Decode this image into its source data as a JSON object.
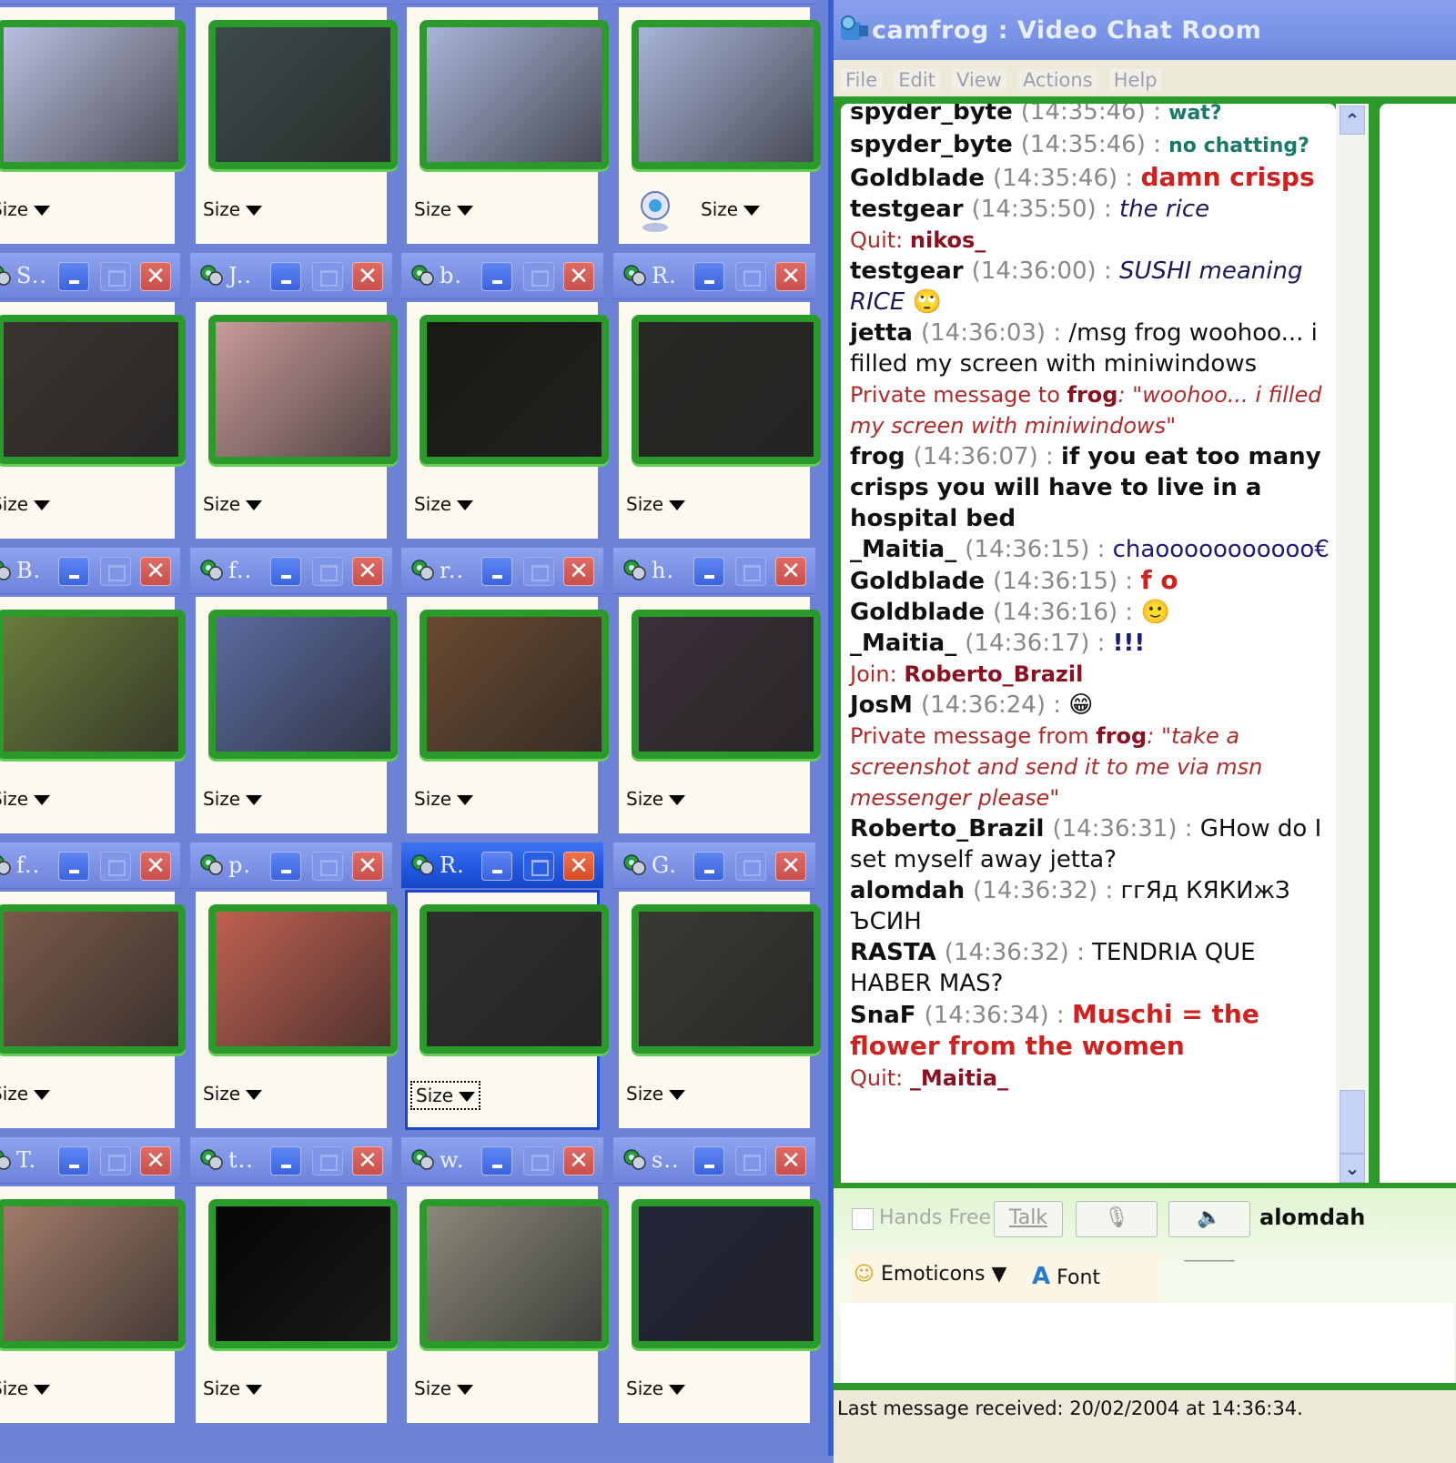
{
  "app": {
    "title": "camfrog : Video Chat Room",
    "menu": [
      "File",
      "Edit",
      "View",
      "Actions",
      "Help"
    ]
  },
  "video_tiles": [
    {
      "title": "",
      "size_label": "Size",
      "active": false,
      "webcam_icon": false,
      "thumb_color": "#b9bfe0"
    },
    {
      "title": "",
      "size_label": "Size",
      "active": false,
      "webcam_icon": false,
      "thumb_color": "#3c4a4a"
    },
    {
      "title": "",
      "size_label": "Size",
      "active": false,
      "webcam_icon": false,
      "thumb_color": "#a8b4d8"
    },
    {
      "title": "",
      "size_label": "Size",
      "active": false,
      "webcam_icon": true,
      "thumb_color": "#a8b4d8"
    },
    {
      "title": "S..",
      "size_label": "Size",
      "active": false,
      "webcam_icon": false,
      "thumb_color": "#3a3430"
    },
    {
      "title": "J..",
      "size_label": "Size",
      "active": false,
      "webcam_icon": false,
      "thumb_color": "#c89a98"
    },
    {
      "title": "b.",
      "size_label": "Size",
      "active": false,
      "webcam_icon": false,
      "thumb_color": "#1a1a14"
    },
    {
      "title": "R.",
      "size_label": "Size",
      "active": false,
      "webcam_icon": false,
      "thumb_color": "#2a2824"
    },
    {
      "title": "B.",
      "size_label": "Size",
      "active": false,
      "webcam_icon": false,
      "thumb_color": "#6a7a3a"
    },
    {
      "title": "f..",
      "size_label": "Size",
      "active": false,
      "webcam_icon": false,
      "thumb_color": "#5a6aa0"
    },
    {
      "title": "r..",
      "size_label": "Size",
      "active": false,
      "webcam_icon": false,
      "thumb_color": "#6a4a30"
    },
    {
      "title": "h.",
      "size_label": "Size",
      "active": false,
      "webcam_icon": false,
      "thumb_color": "#3a3038"
    },
    {
      "title": "f..",
      "size_label": "Size",
      "active": false,
      "webcam_icon": false,
      "thumb_color": "#7a5a4a"
    },
    {
      "title": "p.",
      "size_label": "Size",
      "active": false,
      "webcam_icon": false,
      "thumb_color": "#c06050"
    },
    {
      "title": "R.",
      "size_label": "Size",
      "active": true,
      "webcam_icon": false,
      "thumb_color": "#2e2e2e"
    },
    {
      "title": "G.",
      "size_label": "Size",
      "active": false,
      "webcam_icon": false,
      "thumb_color": "#3a3a34"
    },
    {
      "title": "T.",
      "size_label": "Size",
      "active": false,
      "webcam_icon": false,
      "thumb_color": "#a07a68"
    },
    {
      "title": "t..",
      "size_label": "Size",
      "active": false,
      "webcam_icon": false,
      "thumb_color": "#050505"
    },
    {
      "title": "w.",
      "size_label": "Size",
      "active": false,
      "webcam_icon": false,
      "thumb_color": "#8a8878"
    },
    {
      "title": "s..",
      "size_label": "Size",
      "active": false,
      "webcam_icon": false,
      "thumb_color": "#222438"
    }
  ],
  "chat": {
    "messages": [
      {
        "type": "msg",
        "nick": "spyder_byte",
        "time": "(14:35:46)",
        "text": "wat?",
        "color": "#1a7a6a",
        "style": "comic"
      },
      {
        "type": "msg",
        "nick": "spyder_byte",
        "time": "(14:35:46)",
        "text": "no chatting?",
        "color": "#1a7a6a",
        "style": "comic"
      },
      {
        "type": "msg",
        "nick": "Goldblade",
        "time": "(14:35:46)",
        "text": "damn crisps",
        "color": "#d02020",
        "style": "comic-big"
      },
      {
        "type": "msg",
        "nick": "testgear",
        "time": "(14:35:50)",
        "text": "the rice",
        "color": "#1a1a5a",
        "style": "italic"
      },
      {
        "type": "sys",
        "prefix": "Quit: ",
        "name": "nikos_",
        "suffix": ""
      },
      {
        "type": "msg",
        "nick": "testgear",
        "time": "(14:36:00)",
        "text": "SUSHI meaning RICE",
        "color": "#1a1a5a",
        "style": "italic",
        "emoticon": "rolling-eyes"
      },
      {
        "type": "msg",
        "nick": "jetta",
        "time": "(14:36:03)",
        "text": "/msg frog woohoo... i filled my screen with miniwindows",
        "color": "#111111",
        "style": "plain"
      },
      {
        "type": "sys",
        "prefix": "Private message to ",
        "name": "frog",
        "suffix": ": \"woohoo... i filled my screen with miniwindows\""
      },
      {
        "type": "msg",
        "nick": "frog",
        "time": "(14:36:07)",
        "text": "if you eat too many crisps you will have to live in a hospital bed",
        "color": "#111111",
        "style": "bold"
      },
      {
        "type": "msg",
        "nick": "_Maitia_",
        "time": "(14:36:15)",
        "text": "chaooooooooooo€",
        "color": "#1a1a7a",
        "style": "plain"
      },
      {
        "type": "msg",
        "nick": "Goldblade",
        "time": "(14:36:15)",
        "text": "f o",
        "color": "#d02020",
        "style": "comic-big"
      },
      {
        "type": "msg",
        "nick": "Goldblade",
        "time": "(14:36:16)",
        "text": "",
        "color": "#111111",
        "style": "plain",
        "emoticon": "smile"
      },
      {
        "type": "msg",
        "nick": "_Maitia_",
        "time": "(14:36:17)",
        "text": "!!!",
        "color": "#1a1a7a",
        "style": "bold"
      },
      {
        "type": "sys",
        "prefix": "Join: ",
        "name": "Roberto_Brazil",
        "suffix": ""
      },
      {
        "type": "msg",
        "nick": "JosM",
        "time": "(14:36:24)",
        "text": "",
        "color": "#111111",
        "style": "plain",
        "emoticon": "grin"
      },
      {
        "type": "sys",
        "prefix": "Private message from ",
        "name": "frog",
        "suffix": ": \"take a screenshot and send it to me via msn messenger please\""
      },
      {
        "type": "msg",
        "nick": "Roberto_Brazil",
        "time": "(14:36:31)",
        "text": "GHow do I set myself away  jetta?",
        "color": "#111111",
        "style": "plain"
      },
      {
        "type": "msg",
        "nick": "alomdah",
        "time": "(14:36:32)",
        "text": "ггЯд КЯКИжЗ ЪСИН",
        "color": "#111111",
        "style": "plain"
      },
      {
        "type": "msg",
        "nick": "RASTA",
        "time": "(14:36:32)",
        "text": "TENDRIA QUE HABER MAS?",
        "color": "#111111",
        "style": "plain"
      },
      {
        "type": "msg",
        "nick": "SnaF",
        "time": "(14:36:34)",
        "text": "Muschi = the flower from the women",
        "color": "#d02020",
        "style": "big"
      },
      {
        "type": "sys",
        "prefix": "Quit: ",
        "name": "_Maitia_",
        "suffix": ""
      }
    ]
  },
  "controls": {
    "hands_free_label": "Hands Free",
    "hands_free_checked": false,
    "talk_label": "Talk",
    "mic_level": "_____",
    "speaker_level": "_____",
    "current_user": "alomdah",
    "emoticons_label": "Emoticons",
    "font_label": "Font",
    "message_input_value": ""
  },
  "status": {
    "text": "Last message received: 20/02/2004 at 14:36:34."
  },
  "colors": {
    "accent_green": "#2b9a2b",
    "titlebar_blue": "#7b90e3",
    "active_blue": "#1f55e0",
    "system_red": "#b02a2a"
  }
}
